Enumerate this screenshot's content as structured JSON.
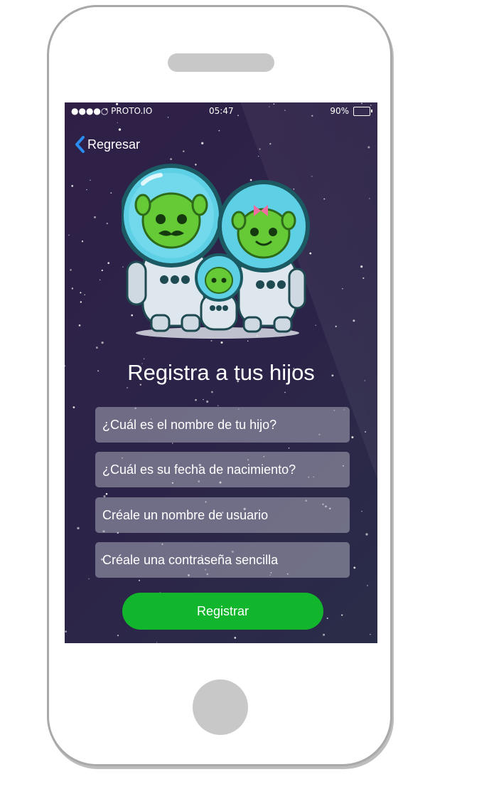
{
  "status_bar": {
    "carrier": "●●●●○ PROTO.IO",
    "time": "05:47",
    "battery_percent": "90%",
    "battery_level": 0.9
  },
  "nav": {
    "back_label": "Regresar",
    "back_icon": "chevron-left-icon"
  },
  "hero": {
    "illustration": "alien-astronaut-family-illustration"
  },
  "title": "Registra a tus hijos",
  "form": {
    "child_name_placeholder": "¿Cuál es el nombre de tu hijo?",
    "birth_date_placeholder": "¿Cuál es su fecha de nacimiento?",
    "username_placeholder": "Créale un nombre de usuario",
    "password_placeholder": "Créale una contraseña sencilla",
    "submit_label": "Registrar"
  },
  "colors": {
    "background": "#2c2448",
    "accent": "#12b62d",
    "back_chevron": "#2a8cf0",
    "field_bg": "#9a97a8"
  }
}
